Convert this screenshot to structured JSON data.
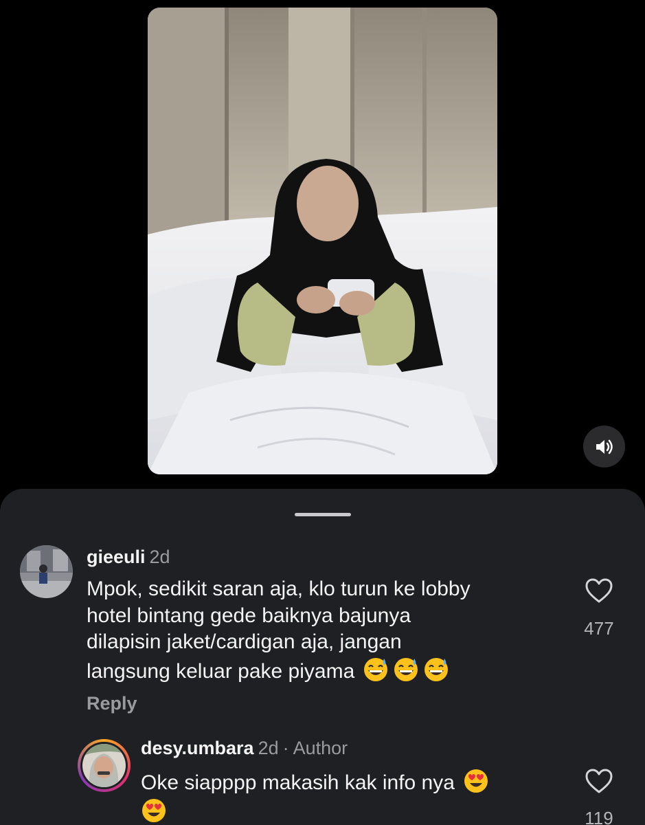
{
  "video": {
    "mute_icon": "speaker-icon"
  },
  "comments": [
    {
      "username": "gieeuli",
      "time": "2d",
      "lines": [
        "Mpok, sedikit saran aja, klo turun ke lobby",
        "hotel bintang gede baiknya bajunya",
        "dilapisin jaket/cardigan aja, jangan",
        "langsung keluar pake piyama"
      ],
      "emojis": [
        "😅",
        "😅",
        "😅"
      ],
      "reply_label": "Reply",
      "likes": "477"
    },
    {
      "username": "desy.umbara",
      "time": "2d",
      "separator": "·",
      "badge": "Author",
      "text": "Oke siapppp makasih kak info nya",
      "emojis": [
        "😍",
        "😍"
      ],
      "likes": "119"
    }
  ],
  "colors": {
    "sheet": "#1f2023",
    "muted": "#9a9b9e",
    "story_ring": "#e1306c"
  }
}
